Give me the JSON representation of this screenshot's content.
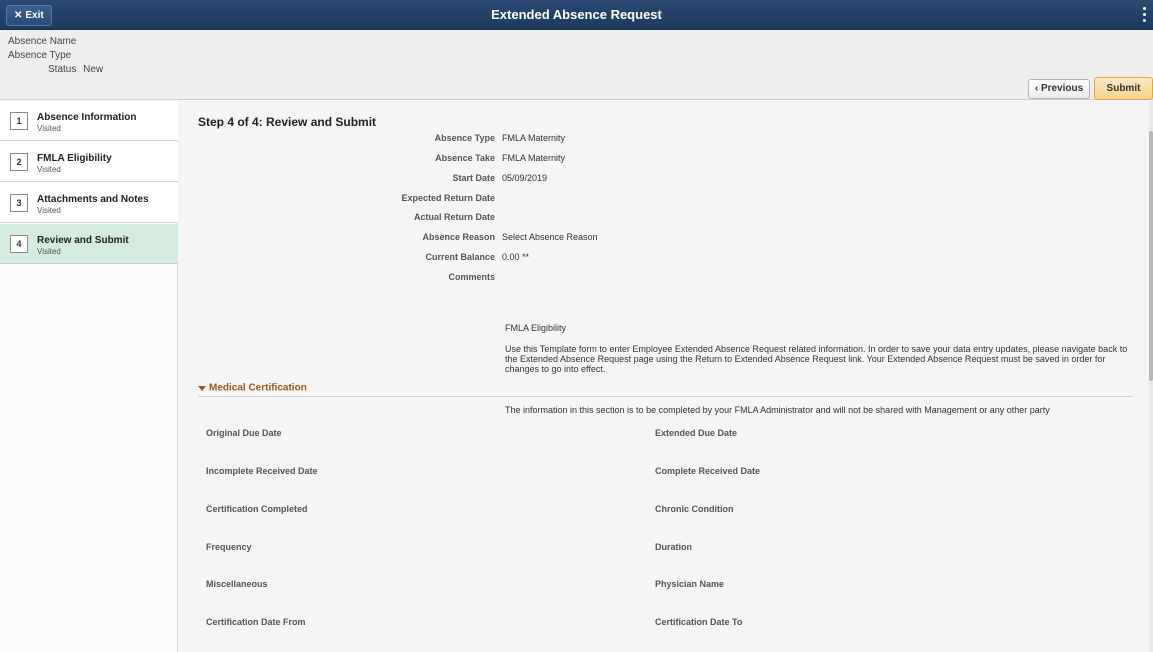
{
  "topbar": {
    "exit_label": "Exit",
    "title": "Extended Absence Request"
  },
  "header": {
    "absence_name_label": "Absence Name",
    "absence_type_label": "Absence Type",
    "status_label": "Status",
    "status_value": "New",
    "previous_label": "Previous",
    "submit_label": "Submit"
  },
  "steps": [
    {
      "num": "1",
      "label": "Absence Information",
      "sub": "Visited"
    },
    {
      "num": "2",
      "label": "FMLA Eligibility",
      "sub": "Visited"
    },
    {
      "num": "3",
      "label": "Attachments and Notes",
      "sub": "Visited"
    },
    {
      "num": "4",
      "label": "Review and Submit",
      "sub": "Visited"
    }
  ],
  "main": {
    "step_title": "Step 4 of 4: Review and Submit",
    "fields": [
      {
        "label": "Absence Type",
        "value": "FMLA Maternity"
      },
      {
        "label": "Absence Take",
        "value": "FMLA Maternity"
      },
      {
        "label": "Start Date",
        "value": "05/09/2019"
      },
      {
        "label": "Expected Return Date",
        "value": ""
      },
      {
        "label": "Actual Return Date",
        "value": ""
      },
      {
        "label": "Absence Reason",
        "value": "Select Absence Reason"
      },
      {
        "label": "Current Balance",
        "value": "0.00 **"
      },
      {
        "label": "Comments",
        "value": ""
      }
    ],
    "fmla_title": "FMLA Eligibility",
    "fmla_text": "Use this Template form to enter Employee Extended Absence Request related information. In order to save your data entry updates, please navigate back to the Extended Absence Request page using the Return to Extended Absence Request link.  Your Extended Absence Request must be saved in order for changes to go into effect.",
    "section_title": "Medical Certification",
    "notice": "The information in this section is to be completed by your FMLA Administrator and will not be shared with Management or any other party",
    "grid": [
      [
        "Original Due Date",
        "Extended Due Date"
      ],
      [
        "Incomplete Received Date",
        "Complete Received Date"
      ],
      [
        "Certification Completed",
        "Chronic Condition"
      ],
      [
        "Frequency",
        "Duration"
      ],
      [
        "Miscellaneous",
        "Physician Name"
      ],
      [
        "Certification Date From",
        "Certification Date To"
      ]
    ]
  },
  "colors": {
    "topbar": "#1e3a5f",
    "active_step": "#d4ecdf",
    "section_accent": "#a3541b",
    "submit_button": "#f8d38d"
  },
  "icons": [
    "close-icon",
    "more-vertical-icon",
    "chevron-left-icon",
    "caret-down-icon"
  ]
}
